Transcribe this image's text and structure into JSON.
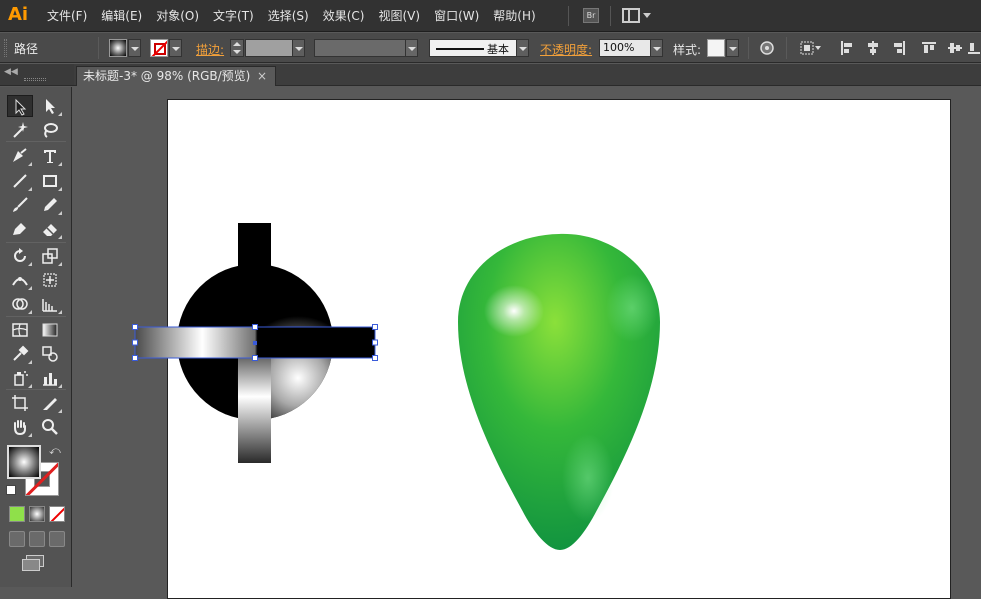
{
  "app": {
    "logo": "Ai"
  },
  "menu": {
    "items": [
      "文件(F)",
      "编辑(E)",
      "对象(O)",
      "文字(T)",
      "选择(S)",
      "效果(C)",
      "视图(V)",
      "窗口(W)",
      "帮助(H)"
    ],
    "bridge_label": "Br"
  },
  "control_bar": {
    "selection_type": "路径",
    "stroke_label": "描边:",
    "stroke_profile_label": "基本",
    "opacity_label": "不透明度:",
    "opacity_value": "100%",
    "style_label": "样式:"
  },
  "document": {
    "tab_title": "未标题-3* @ 98% (RGB/预览)",
    "close_glyph": "×",
    "zoom": "98%",
    "color_mode": "RGB/预览"
  },
  "tools": {
    "icons": [
      "selection-tool-icon",
      "direct-selection-tool-icon",
      "magic-wand-tool-icon",
      "lasso-tool-icon",
      "pen-tool-icon",
      "type-tool-icon",
      "line-segment-tool-icon",
      "rectangle-tool-icon",
      "paintbrush-tool-icon",
      "pencil-tool-icon",
      "blob-brush-tool-icon",
      "eraser-tool-icon",
      "rotate-tool-icon",
      "scale-tool-icon",
      "width-tool-icon",
      "free-transform-tool-icon",
      "shape-builder-tool-icon",
      "perspective-grid-tool-icon",
      "mesh-tool-icon",
      "gradient-tool-icon",
      "eyedropper-tool-icon",
      "blend-tool-icon",
      "symbol-sprayer-tool-icon",
      "column-graph-tool-icon",
      "artboard-tool-icon",
      "slice-tool-icon",
      "hand-tool-icon",
      "zoom-tool-icon"
    ],
    "active_tool": "selection-tool-icon",
    "fill": "radial-gradient",
    "stroke": "none"
  },
  "colors": {
    "accent_orange": "#f2a03a",
    "selection_blue": "#3a5bd9",
    "egg_green_light": "#8be03a",
    "egg_green_dark": "#0f9140",
    "ui_dark": "#323232",
    "ui_mid": "#4a4a4a"
  }
}
